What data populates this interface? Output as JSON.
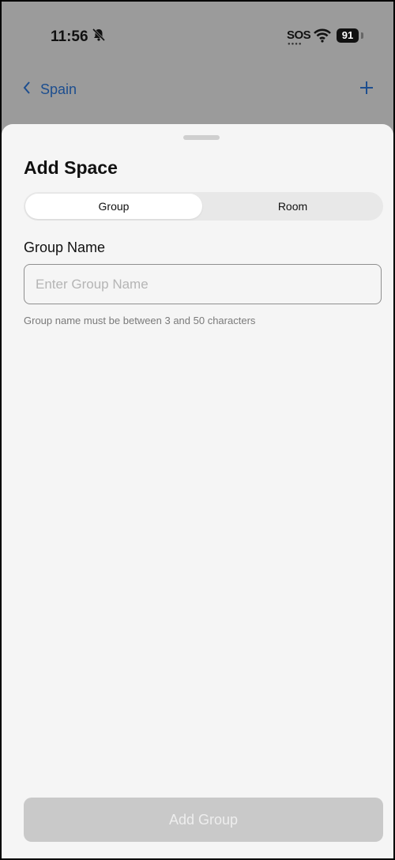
{
  "status_bar": {
    "time": "11:56",
    "sos": "SOS",
    "battery": "91",
    "icons": [
      "bell-slash-icon",
      "wifi-icon",
      "battery-icon"
    ]
  },
  "nav": {
    "back_label": "Spain",
    "icons": [
      "chevron-left-icon",
      "plus-icon"
    ],
    "accent": "#1d4e8f"
  },
  "sheet": {
    "title": "Add Space",
    "segments": {
      "active": "Group",
      "inactive": "Room"
    },
    "field_label": "Group Name",
    "input": {
      "value": "",
      "placeholder": "Enter Group Name"
    },
    "helper": "Group name must be between 3 and 50 characters",
    "submit_label": "Add Group"
  }
}
